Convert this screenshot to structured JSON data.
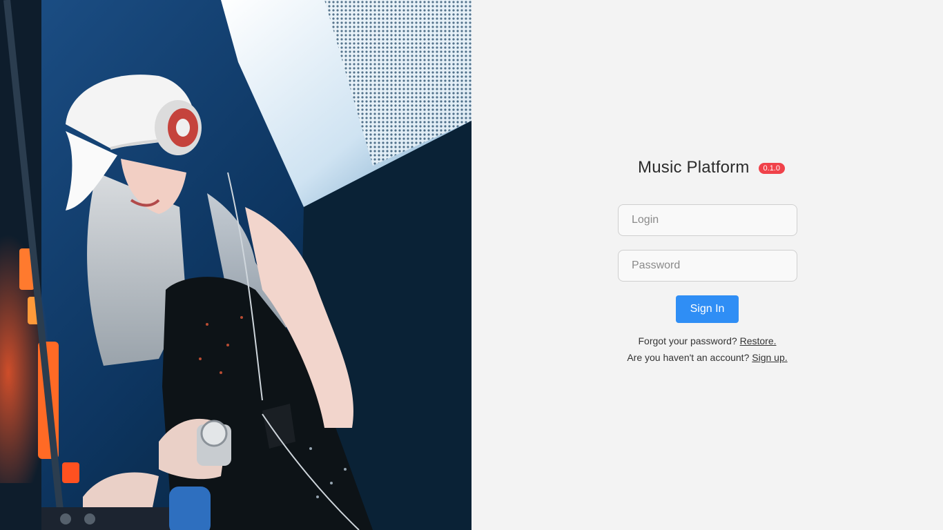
{
  "header": {
    "app_title": "Music Platform",
    "version": "0.1.0"
  },
  "form": {
    "login_placeholder": "Login",
    "login_value": "",
    "password_placeholder": "Password",
    "password_value": "",
    "signin_label": "Sign In"
  },
  "links": {
    "forgot_text": "Forgot your password?",
    "restore_label": "Restore.",
    "signup_text": "Are you haven't an account?",
    "signup_label": "Sign up."
  },
  "hero": {
    "description_icon": "dj-photo"
  },
  "colors": {
    "accent": "#2f8ef5",
    "badge": "#f0424a",
    "background": "#f3f3f3"
  }
}
